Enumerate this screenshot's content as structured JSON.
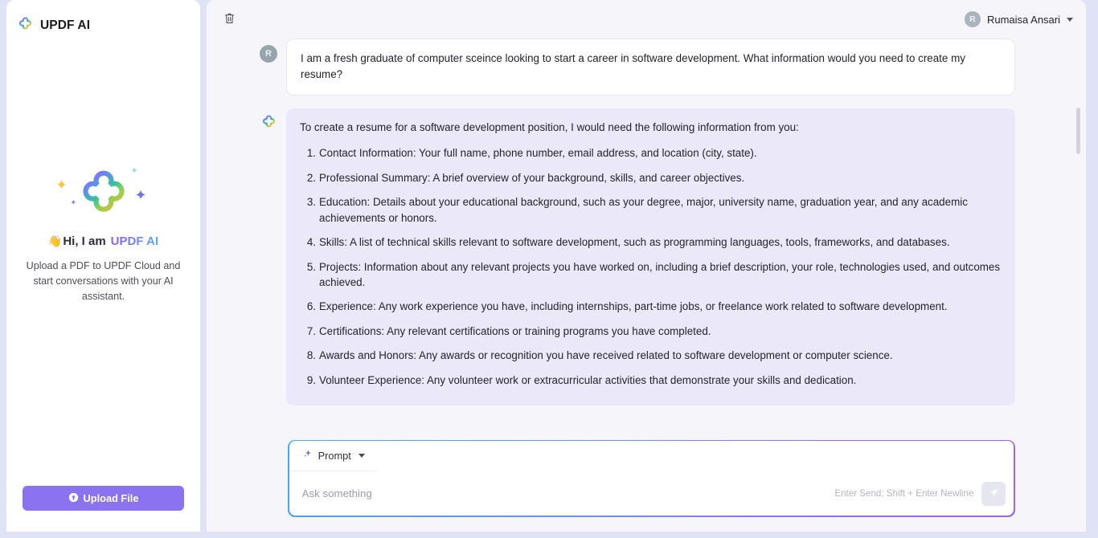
{
  "sidebar": {
    "brand": "UPDF AI",
    "logo_icon": "clover-logo-icon",
    "hero": {
      "icon": "clover-logo-large-icon",
      "wave": "👋",
      "greeting_prefix": "Hi, I am ",
      "greeting_brand": "UPDF AI",
      "description": "Upload a PDF to UPDF Cloud and start conversations with your AI assistant."
    },
    "upload_button": {
      "label": "Upload File",
      "icon": "upload-arrow-icon"
    }
  },
  "topbar": {
    "delete_icon": "trash-icon",
    "user": {
      "initial": "R",
      "name": "Rumaisa Ansari",
      "chevron_icon": "chevron-down-icon"
    }
  },
  "chat": {
    "user_message": {
      "avatar_initial": "R",
      "text": "I am a fresh graduate of computer sceince looking to start a career in software development. What information would you need to create my resume?"
    },
    "ai_message": {
      "avatar_icon": "clover-ai-avatar-icon",
      "intro": "To create a resume for a software development position, I would need the following information from you:",
      "items": [
        "Contact Information: Your full name, phone number, email address, and location (city, state).",
        "Professional Summary: A brief overview of your background, skills, and career objectives.",
        "Education: Details about your educational background, such as your degree, major, university name, graduation year, and any academic achievements or honors.",
        "Skills: A list of technical skills relevant to software development, such as programming languages, tools, frameworks, and databases.",
        "Projects: Information about any relevant projects you have worked on, including a brief description, your role, technologies used, and outcomes achieved.",
        "Experience: Any work experience you have, including internships, part-time jobs, or freelance work related to software development.",
        "Certifications: Any relevant certifications or training programs you have completed.",
        "Awards and Honors: Any awards or recognition you have received related to software development or computer science.",
        "Volunteer Experience: Any volunteer work or extracurricular activities that demonstrate your skills and dedication."
      ]
    }
  },
  "composer": {
    "prompt_label": "Prompt",
    "prompt_icon": "sparkle-icon",
    "prompt_caret_icon": "caret-down-icon",
    "input_value": "",
    "input_placeholder": "Ask something",
    "hint": "Enter Send; Shift + Enter Newline",
    "send_icon": "send-paper-plane-icon"
  },
  "colors": {
    "page_background": "#dfe3f5",
    "panel_background": "#f6f6fa",
    "ai_bubble": "#ebe9f9",
    "accent_purple": "#8b72f0",
    "composer_border_start": "#49a7ef",
    "composer_border_end": "#9a67f2"
  }
}
